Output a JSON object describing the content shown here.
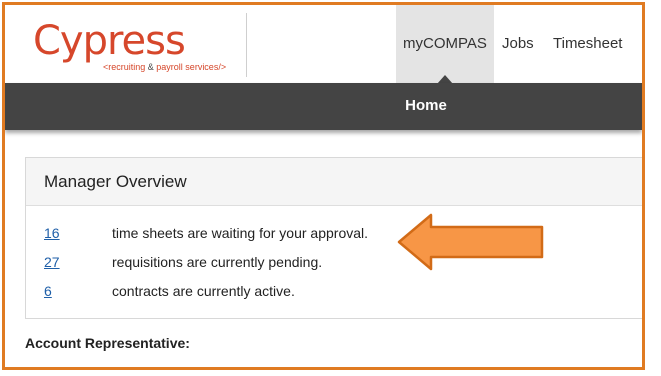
{
  "logo": {
    "wordmark": "Cypress",
    "tagline_prefix": "<recruiting ",
    "tagline_amp": "&",
    "tagline_suffix": " payroll services/>"
  },
  "nav": {
    "active": "myCOMPAS",
    "jobs": "Jobs",
    "timesheet": "Timesheet"
  },
  "subnav": {
    "home": "Home"
  },
  "overview": {
    "title": "Manager Overview",
    "rows": [
      {
        "count": "16",
        "text": "time sheets are waiting for your approval."
      },
      {
        "count": "27",
        "text": "requisitions are currently pending."
      },
      {
        "count": "6",
        "text": "contracts are currently active."
      }
    ]
  },
  "account": {
    "label": "Account Representative:"
  },
  "colors": {
    "frame": "#e07b22",
    "brand": "#d6472b",
    "subbar": "#444444",
    "link": "#1f5fa8",
    "arrow_fill": "#f79646",
    "arrow_stroke": "#d26b17"
  }
}
